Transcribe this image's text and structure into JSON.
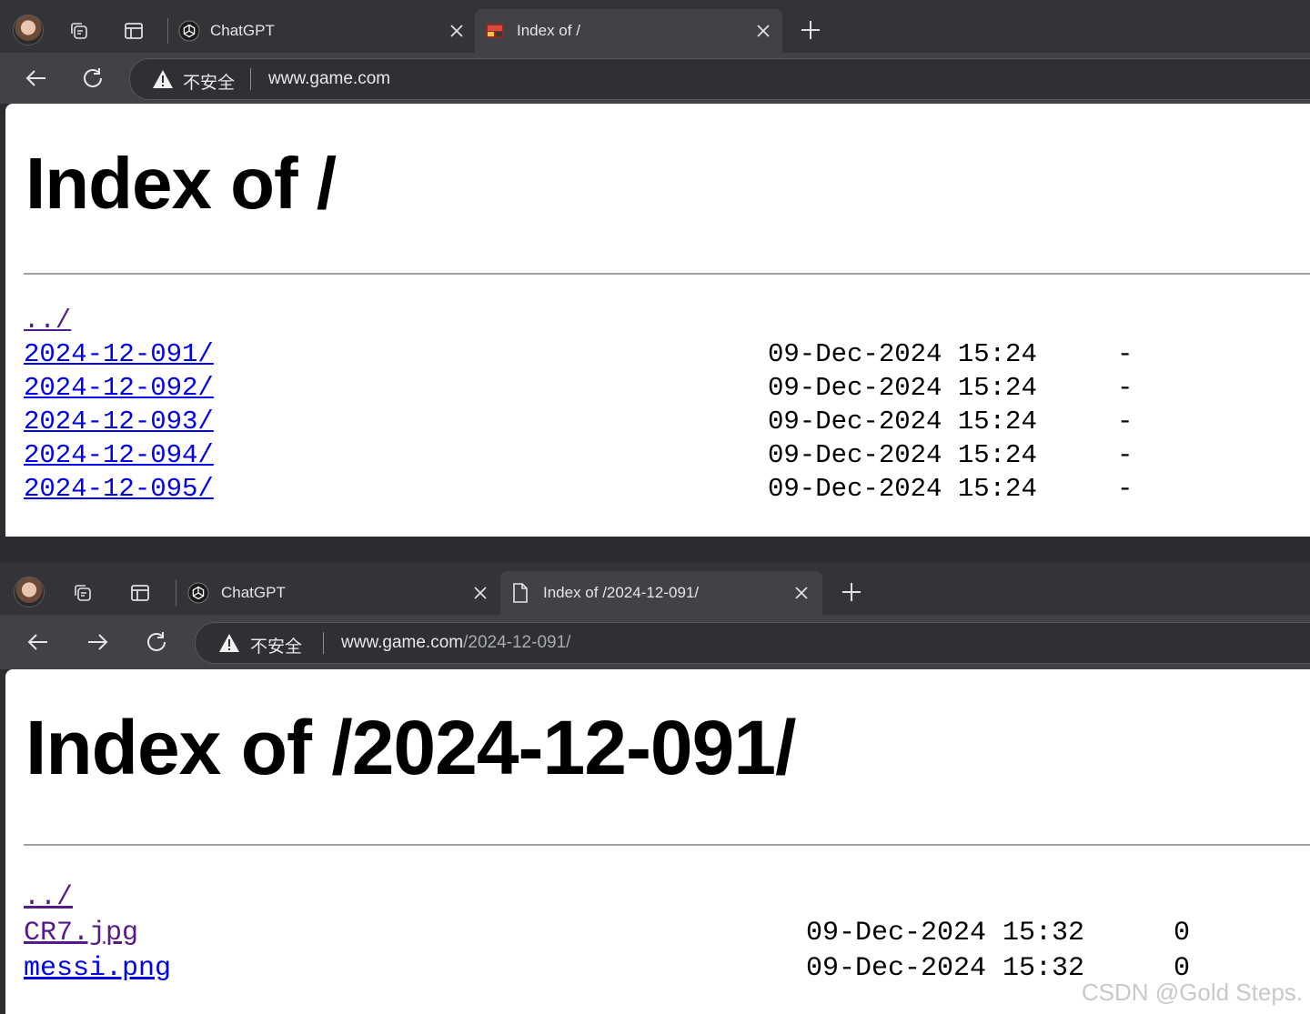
{
  "top": {
    "tabs": [
      {
        "title": "ChatGPT",
        "favicon": "chatgpt-icon",
        "active": false
      },
      {
        "title": "Index of /",
        "favicon": "game-favicon",
        "active": true
      }
    ],
    "address": {
      "security_label": "不安全",
      "host": "www.game.com",
      "path": ""
    },
    "page": {
      "heading": "Index of /",
      "parent_link": "../",
      "entries": [
        {
          "name": "2024-12-091/",
          "date": "09-Dec-2024 15:24",
          "size": "-"
        },
        {
          "name": "2024-12-092/",
          "date": "09-Dec-2024 15:24",
          "size": "-"
        },
        {
          "name": "2024-12-093/",
          "date": "09-Dec-2024 15:24",
          "size": "-"
        },
        {
          "name": "2024-12-094/",
          "date": "09-Dec-2024 15:24",
          "size": "-"
        },
        {
          "name": "2024-12-095/",
          "date": "09-Dec-2024 15:24",
          "size": "-"
        }
      ]
    }
  },
  "bottom": {
    "tabs": [
      {
        "title": "ChatGPT",
        "favicon": "chatgpt-icon",
        "active": false
      },
      {
        "title": "Index of /2024-12-091/",
        "favicon": "page-icon",
        "active": true
      }
    ],
    "address": {
      "security_label": "不安全",
      "host": "www.game.com",
      "path": "/2024-12-091/"
    },
    "page": {
      "heading": "Index of /2024-12-091/",
      "parent_link": "../",
      "entries": [
        {
          "name": "CR7.jpg",
          "date": "09-Dec-2024 15:32",
          "size": "0"
        },
        {
          "name": "messi.png",
          "date": "09-Dec-2024 15:32",
          "size": "0"
        }
      ]
    }
  },
  "watermark": "CSDN @Gold Steps.",
  "colors": {
    "link": "#0000ee",
    "visited_link": "#551a8b",
    "tab_active": "#404246",
    "tabstrip": "#323438"
  }
}
